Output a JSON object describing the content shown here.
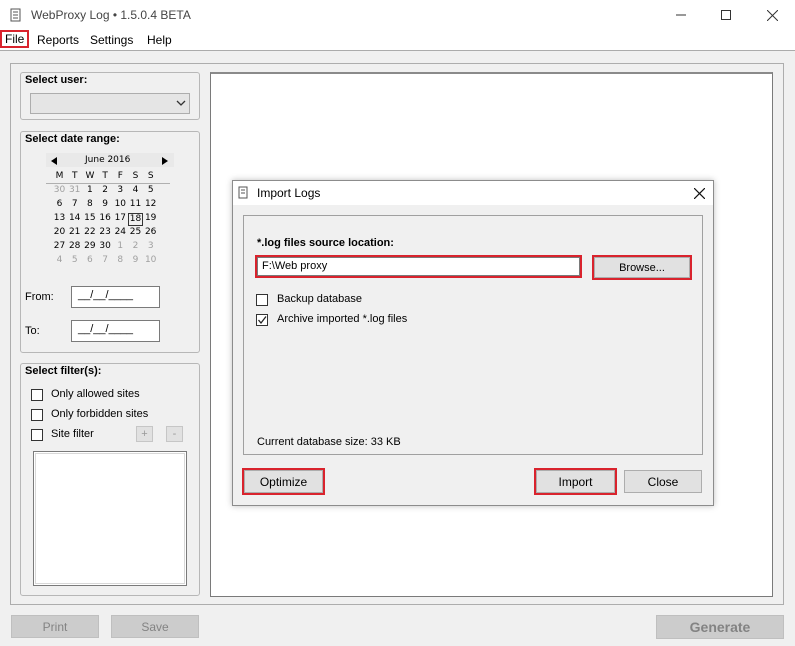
{
  "window": {
    "title": "WebProxy Log • 1.5.0.4 BETA",
    "minimize_icon": "minimize-icon",
    "maximize_icon": "maximize-icon",
    "close_icon": "close-icon"
  },
  "menu": {
    "items": [
      "File",
      "Reports",
      "Settings",
      "Help"
    ]
  },
  "sidebar": {
    "select_user": {
      "title": "Select user:",
      "value": ""
    },
    "date_range": {
      "title": "Select date range:",
      "calendar": {
        "month_label": "June 2016",
        "weekdays": [
          "M",
          "T",
          "W",
          "T",
          "F",
          "S",
          "S"
        ],
        "weeks": [
          [
            [
              "30",
              "g"
            ],
            [
              "31",
              "g"
            ],
            [
              "1",
              ""
            ],
            [
              "2",
              ""
            ],
            [
              "3",
              ""
            ],
            [
              "4",
              ""
            ],
            [
              "5",
              ""
            ]
          ],
          [
            [
              "6",
              ""
            ],
            [
              "7",
              ""
            ],
            [
              "8",
              ""
            ],
            [
              "9",
              ""
            ],
            [
              "10",
              ""
            ],
            [
              "11",
              ""
            ],
            [
              "12",
              ""
            ]
          ],
          [
            [
              "13",
              ""
            ],
            [
              "14",
              ""
            ],
            [
              "15",
              ""
            ],
            [
              "16",
              ""
            ],
            [
              "17",
              ""
            ],
            [
              "18",
              "t"
            ],
            [
              "19",
              ""
            ]
          ],
          [
            [
              "20",
              ""
            ],
            [
              "21",
              ""
            ],
            [
              "22",
              ""
            ],
            [
              "23",
              ""
            ],
            [
              "24",
              ""
            ],
            [
              "25",
              ""
            ],
            [
              "26",
              ""
            ]
          ],
          [
            [
              "27",
              ""
            ],
            [
              "28",
              ""
            ],
            [
              "29",
              ""
            ],
            [
              "30",
              ""
            ],
            [
              "1",
              "g"
            ],
            [
              "2",
              "g"
            ],
            [
              "3",
              "g"
            ]
          ],
          [
            [
              "4",
              "g"
            ],
            [
              "5",
              "g"
            ],
            [
              "6",
              "g"
            ],
            [
              "7",
              "g"
            ],
            [
              "8",
              "g"
            ],
            [
              "9",
              "g"
            ],
            [
              "10",
              "g"
            ]
          ]
        ]
      },
      "from_label": "From:",
      "from_value": "__/__/____",
      "to_label": "To:",
      "to_value": "__/__/____"
    },
    "filters": {
      "title": "Select filter(s):",
      "only_allowed": "Only allowed sites",
      "only_forbidden": "Only forbidden sites",
      "site_filter": "Site filter",
      "add": "+",
      "remove": "-"
    }
  },
  "bottom": {
    "print": "Print",
    "save": "Save",
    "generate": "Generate"
  },
  "dialog": {
    "title": "Import Logs",
    "source_label": "*.log files source location:",
    "source_value": "F:\\Web proxy",
    "browse": "Browse...",
    "backup_label": "Backup database",
    "backup_checked": false,
    "archive_label": "Archive imported *.log files",
    "archive_checked": true,
    "db_size": "Current database size: 33 KB",
    "optimize": "Optimize",
    "import": "Import",
    "close": "Close"
  },
  "colors": {
    "highlight": "#d9232d"
  }
}
